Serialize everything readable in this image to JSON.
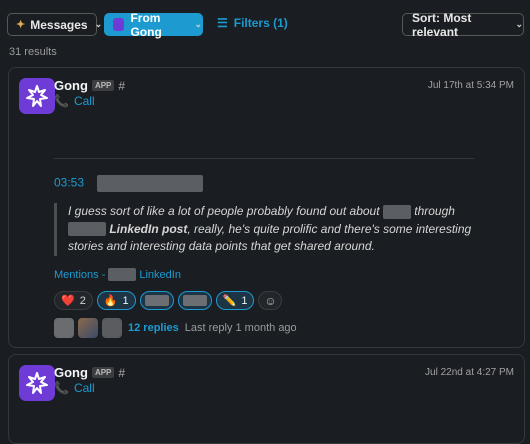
{
  "toolbar": {
    "messages_label": "Messages",
    "from_label": "From Gong",
    "filters_label": "Filters (1)",
    "sort_label": "Sort: Most relevant"
  },
  "results_count": "31 results",
  "messages": [
    {
      "sender": "Gong",
      "app_badge": "APP",
      "timestamp": "Jul 17th at 5:34 PM",
      "call_label": "Call",
      "time_code": "03:53",
      "quote": {
        "part1": "I guess sort of like a lot of people probably found out about",
        "part2": "through",
        "bold": "LinkedIn post",
        "part3": ", really, he's quite prolific and there's some interesting stories and interesting data points that get shared around."
      },
      "mentions_label": "Mentions -",
      "mentions_link": "LinkedIn",
      "reactions": [
        {
          "emoji": "❤️",
          "count": "2"
        },
        {
          "emoji": "🔥",
          "count": "1"
        },
        {
          "emoji": "✏️",
          "count": "1"
        }
      ],
      "replies_label": "12 replies",
      "last_reply": "Last reply 1 month ago"
    },
    {
      "sender": "Gong",
      "app_badge": "APP",
      "timestamp": "Jul 22nd at 4:27 PM",
      "call_label": "Call"
    }
  ]
}
